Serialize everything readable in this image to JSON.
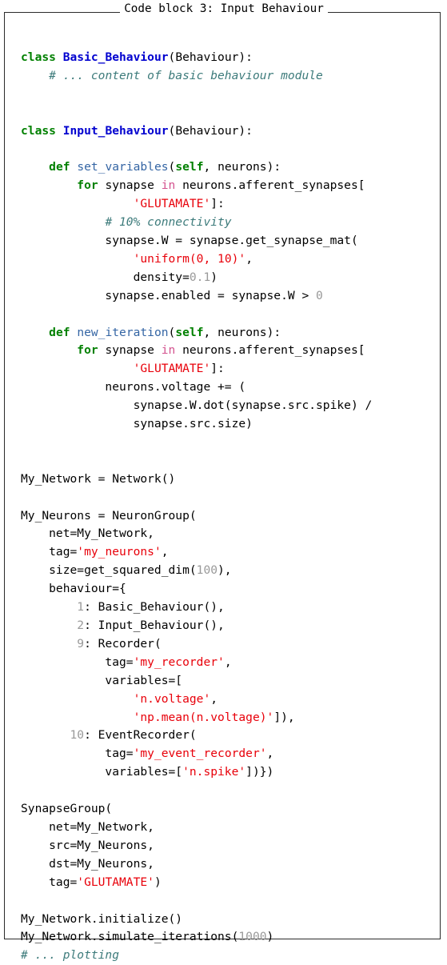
{
  "figure": {
    "caption": "Code block 3: Input Behaviour",
    "border_color": "#2b2b2b",
    "background": "#ffffff"
  },
  "theme": {
    "keyword": "#008000",
    "class_name": "#0000CF",
    "function_name": "#3465A4",
    "string": "#E8000A",
    "number": "#999999",
    "operator_word": "#D4538F",
    "comment": "#3D7B7B",
    "plain": "#000000"
  },
  "code": {
    "language": "python",
    "lines": [
      [],
      [
        {
          "t": "kw",
          "v": "class"
        },
        {
          "t": "plain",
          "v": " "
        },
        {
          "t": "cls",
          "v": "Basic_Behaviour"
        },
        {
          "t": "plain",
          "v": "(Behaviour):"
        }
      ],
      [
        {
          "t": "plain",
          "v": "    "
        },
        {
          "t": "cmt",
          "v": "# ... content of basic behaviour module"
        }
      ],
      [],
      [],
      [
        {
          "t": "kw",
          "v": "class"
        },
        {
          "t": "plain",
          "v": " "
        },
        {
          "t": "cls",
          "v": "Input_Behaviour"
        },
        {
          "t": "plain",
          "v": "(Behaviour):"
        }
      ],
      [],
      [
        {
          "t": "plain",
          "v": "    "
        },
        {
          "t": "kw",
          "v": "def"
        },
        {
          "t": "plain",
          "v": " "
        },
        {
          "t": "fn",
          "v": "set_variables"
        },
        {
          "t": "plain",
          "v": "("
        },
        {
          "t": "kw",
          "v": "self"
        },
        {
          "t": "plain",
          "v": ", neurons):"
        }
      ],
      [
        {
          "t": "plain",
          "v": "        "
        },
        {
          "t": "kw",
          "v": "for"
        },
        {
          "t": "plain",
          "v": " synapse "
        },
        {
          "t": "op",
          "v": "in"
        },
        {
          "t": "plain",
          "v": " neurons.afferent_synapses["
        }
      ],
      [
        {
          "t": "plain",
          "v": "                "
        },
        {
          "t": "str",
          "v": "'GLUTAMATE'"
        },
        {
          "t": "plain",
          "v": "]:"
        }
      ],
      [
        {
          "t": "plain",
          "v": "            "
        },
        {
          "t": "cmt",
          "v": "# 10% connectivity"
        }
      ],
      [
        {
          "t": "plain",
          "v": "            synapse.W = synapse.get_synapse_mat("
        }
      ],
      [
        {
          "t": "plain",
          "v": "                "
        },
        {
          "t": "str",
          "v": "'uniform(0, 10)'"
        },
        {
          "t": "plain",
          "v": ","
        }
      ],
      [
        {
          "t": "plain",
          "v": "                density="
        },
        {
          "t": "num",
          "v": "0.1"
        },
        {
          "t": "plain",
          "v": ")"
        }
      ],
      [
        {
          "t": "plain",
          "v": "            synapse.enabled = synapse.W > "
        },
        {
          "t": "num",
          "v": "0"
        }
      ],
      [],
      [
        {
          "t": "plain",
          "v": "    "
        },
        {
          "t": "kw",
          "v": "def"
        },
        {
          "t": "plain",
          "v": " "
        },
        {
          "t": "fn",
          "v": "new_iteration"
        },
        {
          "t": "plain",
          "v": "("
        },
        {
          "t": "kw",
          "v": "self"
        },
        {
          "t": "plain",
          "v": ", neurons):"
        }
      ],
      [
        {
          "t": "plain",
          "v": "        "
        },
        {
          "t": "kw",
          "v": "for"
        },
        {
          "t": "plain",
          "v": " synapse "
        },
        {
          "t": "op",
          "v": "in"
        },
        {
          "t": "plain",
          "v": " neurons.afferent_synapses["
        }
      ],
      [
        {
          "t": "plain",
          "v": "                "
        },
        {
          "t": "str",
          "v": "'GLUTAMATE'"
        },
        {
          "t": "plain",
          "v": "]:"
        }
      ],
      [
        {
          "t": "plain",
          "v": "            neurons.voltage += ("
        }
      ],
      [
        {
          "t": "plain",
          "v": "                synapse.W.dot(synapse.src.spike) /"
        }
      ],
      [
        {
          "t": "plain",
          "v": "                synapse.src.size)"
        }
      ],
      [],
      [],
      [
        {
          "t": "plain",
          "v": "My_Network = Network()"
        }
      ],
      [],
      [
        {
          "t": "plain",
          "v": "My_Neurons = NeuronGroup("
        }
      ],
      [
        {
          "t": "plain",
          "v": "    net=My_Network,"
        }
      ],
      [
        {
          "t": "plain",
          "v": "    tag="
        },
        {
          "t": "str",
          "v": "'my_neurons'"
        },
        {
          "t": "plain",
          "v": ","
        }
      ],
      [
        {
          "t": "plain",
          "v": "    size=get_squared_dim("
        },
        {
          "t": "num",
          "v": "100"
        },
        {
          "t": "plain",
          "v": "),"
        }
      ],
      [
        {
          "t": "plain",
          "v": "    behaviour={"
        }
      ],
      [
        {
          "t": "plain",
          "v": "        "
        },
        {
          "t": "num",
          "v": "1"
        },
        {
          "t": "plain",
          "v": ": Basic_Behaviour(),"
        }
      ],
      [
        {
          "t": "plain",
          "v": "        "
        },
        {
          "t": "num",
          "v": "2"
        },
        {
          "t": "plain",
          "v": ": Input_Behaviour(),"
        }
      ],
      [
        {
          "t": "plain",
          "v": "        "
        },
        {
          "t": "num",
          "v": "9"
        },
        {
          "t": "plain",
          "v": ": Recorder("
        }
      ],
      [
        {
          "t": "plain",
          "v": "            tag="
        },
        {
          "t": "str",
          "v": "'my_recorder'"
        },
        {
          "t": "plain",
          "v": ","
        }
      ],
      [
        {
          "t": "plain",
          "v": "            variables=["
        }
      ],
      [
        {
          "t": "plain",
          "v": "                "
        },
        {
          "t": "str",
          "v": "'n.voltage'"
        },
        {
          "t": "plain",
          "v": ","
        }
      ],
      [
        {
          "t": "plain",
          "v": "                "
        },
        {
          "t": "str",
          "v": "'np.mean(n.voltage)'"
        },
        {
          "t": "plain",
          "v": "]),"
        }
      ],
      [
        {
          "t": "plain",
          "v": "       "
        },
        {
          "t": "num",
          "v": "10"
        },
        {
          "t": "plain",
          "v": ": EventRecorder("
        }
      ],
      [
        {
          "t": "plain",
          "v": "            tag="
        },
        {
          "t": "str",
          "v": "'my_event_recorder'"
        },
        {
          "t": "plain",
          "v": ","
        }
      ],
      [
        {
          "t": "plain",
          "v": "            variables=["
        },
        {
          "t": "str",
          "v": "'n.spike'"
        },
        {
          "t": "plain",
          "v": "])})"
        }
      ],
      [],
      [
        {
          "t": "plain",
          "v": "SynapseGroup("
        }
      ],
      [
        {
          "t": "plain",
          "v": "    net=My_Network,"
        }
      ],
      [
        {
          "t": "plain",
          "v": "    src=My_Neurons,"
        }
      ],
      [
        {
          "t": "plain",
          "v": "    dst=My_Neurons,"
        }
      ],
      [
        {
          "t": "plain",
          "v": "    tag="
        },
        {
          "t": "str",
          "v": "'GLUTAMATE'"
        },
        {
          "t": "plain",
          "v": ")"
        }
      ],
      [],
      [
        {
          "t": "plain",
          "v": "My_Network.initialize()"
        }
      ],
      [
        {
          "t": "plain",
          "v": "My_Network.simulate_iterations("
        },
        {
          "t": "num",
          "v": "1000"
        },
        {
          "t": "plain",
          "v": ")"
        }
      ],
      [
        {
          "t": "cmt",
          "v": "# ... plotting"
        }
      ]
    ]
  }
}
